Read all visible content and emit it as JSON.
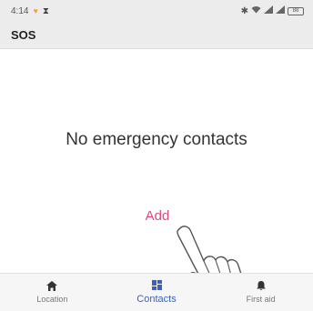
{
  "status_bar": {
    "time": "4:14",
    "battery": "88"
  },
  "app_bar": {
    "title": "SOS"
  },
  "main": {
    "empty_message": "No emergency contacts",
    "add_label": "Add"
  },
  "bottom_nav": {
    "items": [
      {
        "label": "Location",
        "icon": "home-icon"
      },
      {
        "label": "Contacts",
        "icon": "grid-icon"
      },
      {
        "label": "First aid",
        "icon": "bell-icon"
      }
    ],
    "active_index": 1
  },
  "colors": {
    "accent": "#e3467a",
    "active_nav": "#3b5fc8",
    "tap_indicator": "#3aa9b6"
  }
}
